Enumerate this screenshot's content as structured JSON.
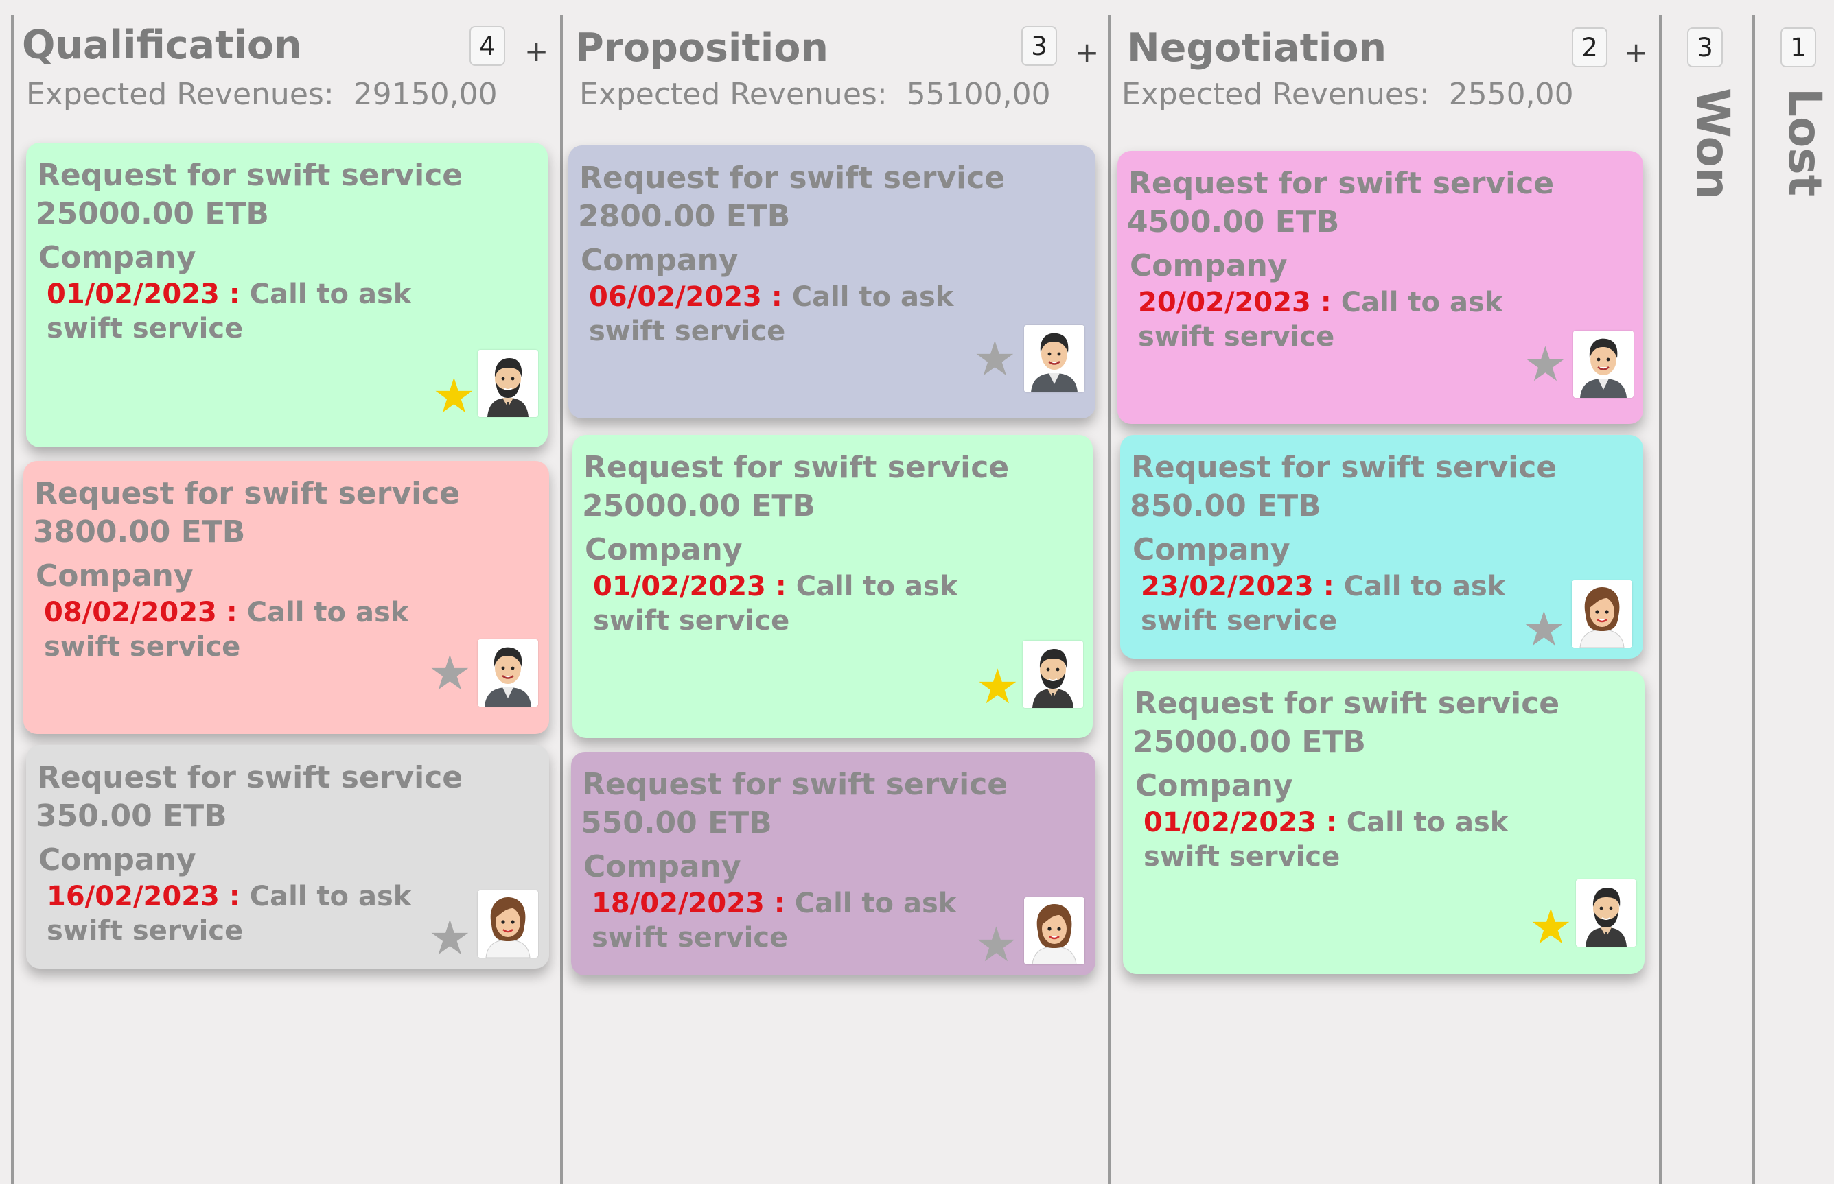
{
  "columns": [
    {
      "title": "Qualification",
      "revenue_label": "Expected Revenues:",
      "revenue": "29150,00",
      "count": "4",
      "add_label": "+",
      "cards": [
        {
          "name": "Request for swift service",
          "amount": "25000.00 ETB",
          "company": "Company",
          "date": "01/02/2023",
          "sep": " : ",
          "activity": "Call to ask swift service",
          "starred": true,
          "avatar": "man-beard",
          "color": "#c5ffd6"
        },
        {
          "name": "Request for swift service",
          "amount": "3800.00 ETB",
          "company": "Company",
          "date": "08/02/2023",
          "sep": " : ",
          "activity": "Call to ask swift service",
          "starred": false,
          "avatar": "man-suit",
          "color": "#ffc5c5"
        },
        {
          "name": "Request for swift service",
          "amount": "350.00 ETB",
          "company": "Company",
          "date": "16/02/2023",
          "sep": " : ",
          "activity": "Call to ask swift service",
          "starred": false,
          "avatar": "woman",
          "color": "#dedede"
        }
      ]
    },
    {
      "title": "Proposition",
      "revenue_label": "Expected Revenues:",
      "revenue": "55100,00",
      "count": "3",
      "add_label": "+",
      "cards": [
        {
          "name": "Request for swift service",
          "amount": "2800.00 ETB",
          "company": "Company",
          "date": "06/02/2023",
          "sep": " : ",
          "activity": "Call to ask swift service",
          "starred": false,
          "avatar": "man-suit",
          "color": "#c5c9dd"
        },
        {
          "name": "Request for swift service",
          "amount": "25000.00 ETB",
          "company": "Company",
          "date": "01/02/2023",
          "sep": " : ",
          "activity": "Call to ask swift service",
          "starred": true,
          "avatar": "man-beard",
          "color": "#c5ffd6"
        },
        {
          "name": "Request for swift service",
          "amount": "550.00 ETB",
          "company": "Company",
          "date": "18/02/2023",
          "sep": " : ",
          "activity": "Call to ask swift service",
          "starred": false,
          "avatar": "woman",
          "color": "#ccaccd"
        }
      ]
    },
    {
      "title": "Negotiation",
      "revenue_label": "Expected Revenues:",
      "revenue": "2550,00",
      "count": "2",
      "add_label": "+",
      "cards": [
        {
          "name": "Request for swift service",
          "amount": "4500.00 ETB",
          "company": "Company",
          "date": "20/02/2023",
          "sep": " : ",
          "activity": "Call to ask swift service",
          "starred": false,
          "avatar": "man-suit",
          "color": "#f5b0e5"
        },
        {
          "name": "Request for swift service",
          "amount": "850.00 ETB",
          "company": "Company",
          "date": "23/02/2023",
          "sep": " : ",
          "activity": "Call to ask swift service",
          "starred": false,
          "avatar": "woman",
          "color": "#9ef2ee"
        },
        {
          "name": "Request for swift service",
          "amount": "25000.00 ETB",
          "company": "Company",
          "date": "01/02/2023",
          "sep": " : ",
          "activity": "Call to ask swift service",
          "starred": true,
          "avatar": "man-beard",
          "color": "#c5ffd6"
        }
      ]
    }
  ],
  "folded": [
    {
      "title": "Won",
      "count": "3"
    },
    {
      "title": "Lost",
      "count": "1"
    }
  ],
  "icons": {
    "star": "star-icon",
    "avatar": "avatar"
  },
  "colors": {
    "star_on": "#f7d000",
    "star_off": "#a5a5a5",
    "date": "#e0141c"
  }
}
